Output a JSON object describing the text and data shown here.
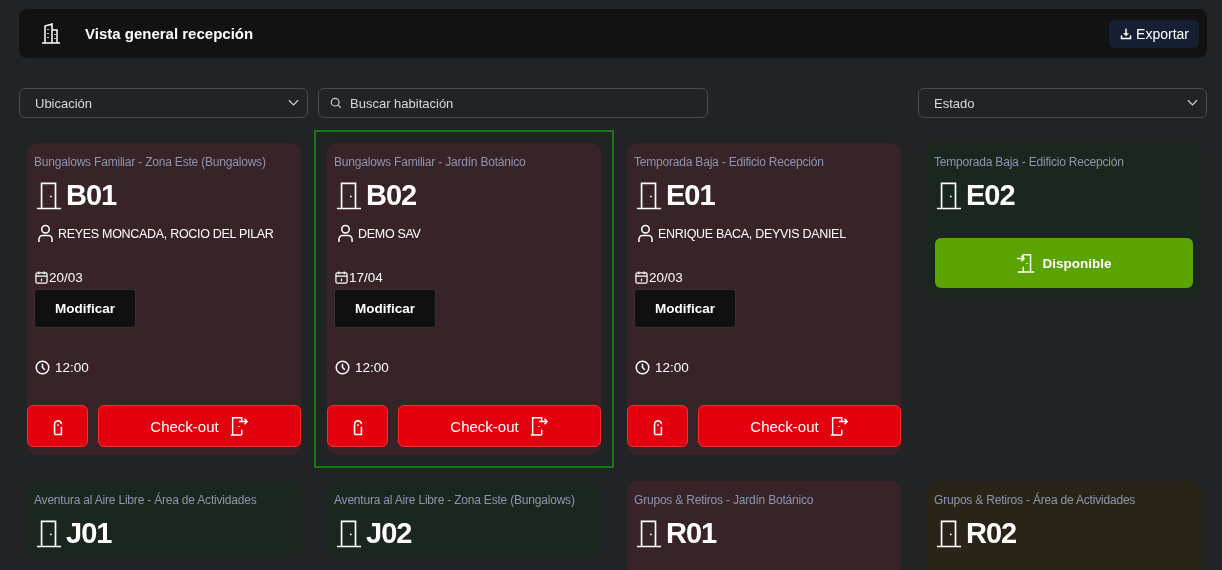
{
  "header": {
    "title": "Vista general recepción",
    "export_label": "Exportar"
  },
  "filters": {
    "location": {
      "placeholder": "Ubicación"
    },
    "search": {
      "placeholder": "Buscar habitación"
    },
    "status": {
      "placeholder": "Estado"
    }
  },
  "rooms": [
    {
      "location": "Bungalows Familiar - Zona Este (Bungalows)",
      "number": "B01",
      "kind": "occupied",
      "selected": false,
      "guest": "REYES MONCADA, ROCIO DEL PILAR",
      "date": "20/03",
      "modify_label": "Modificar",
      "time": "12:00",
      "checkout_label": "Check-out"
    },
    {
      "location": "Bungalows Familiar - Jardín Botánico",
      "number": "B02",
      "kind": "occupied",
      "selected": true,
      "guest": "DEMO SAV",
      "date": "17/04",
      "modify_label": "Modificar",
      "time": "12:00",
      "checkout_label": "Check-out"
    },
    {
      "location": "Temporada Baja - Edificio Recepción",
      "number": "E01",
      "kind": "occupied",
      "selected": false,
      "guest": "ENRIQUE BACA, DEYVIS DANIEL",
      "date": "20/03",
      "modify_label": "Modificar",
      "time": "12:00",
      "checkout_label": "Check-out"
    },
    {
      "location": "Temporada Baja - Edificio Recepción",
      "number": "E02",
      "kind": "available",
      "selected": false,
      "action_label": "Disponible"
    },
    {
      "location": "Aventura al Aire Libre - Área de Actividades",
      "number": "J01",
      "kind": "available",
      "selected": false
    },
    {
      "location": "Aventura al Aire Libre - Zona Este (Bungalows)",
      "number": "J02",
      "kind": "available",
      "selected": false
    },
    {
      "location": "Grupos & Retiros - Jardín Botánico",
      "number": "R01",
      "kind": "occupied",
      "selected": false
    },
    {
      "location": "Grupos & Retiros - Área de Actividades",
      "number": "R02",
      "kind": "reserved",
      "selected": false
    }
  ]
}
